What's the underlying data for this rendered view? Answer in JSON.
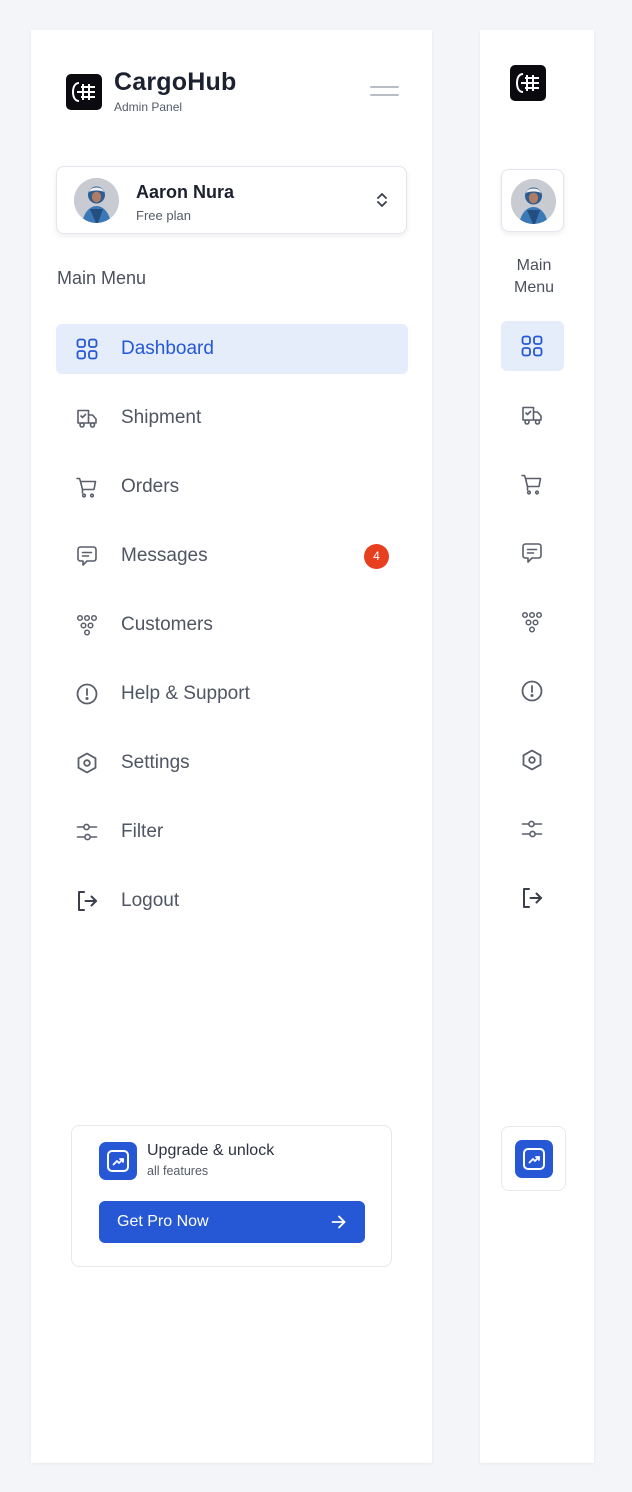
{
  "brand": {
    "name": "CargoHub",
    "subtitle": "Admin Panel"
  },
  "user": {
    "name": "Aaron Nura",
    "plan": "Free plan"
  },
  "menu": {
    "title": "Main Menu",
    "mini_title_line1": "Main",
    "mini_title_line2": "Menu",
    "items": [
      {
        "label": "Dashboard",
        "icon": "grid-icon",
        "active": true
      },
      {
        "label": "Shipment",
        "icon": "truck-icon"
      },
      {
        "label": "Orders",
        "icon": "cart-icon"
      },
      {
        "label": "Messages",
        "icon": "chat-icon",
        "badge": "4"
      },
      {
        "label": "Customers",
        "icon": "customers-icon"
      },
      {
        "label": "Help & Support",
        "icon": "alert-circle-icon"
      },
      {
        "label": "Settings",
        "icon": "settings-hexagon-icon"
      },
      {
        "label": "Filter",
        "icon": "sliders-icon"
      },
      {
        "label": "Logout",
        "icon": "logout-icon"
      }
    ]
  },
  "promo": {
    "title": "Upgrade & unlock",
    "subtitle": "all features",
    "button": "Get Pro Now",
    "icon": "trend-icon"
  },
  "colors": {
    "accent": "#2658d6",
    "active_bg": "#e5edfb",
    "badge": "#e8401f",
    "text": "#505563",
    "background": "#f4f5f8"
  }
}
